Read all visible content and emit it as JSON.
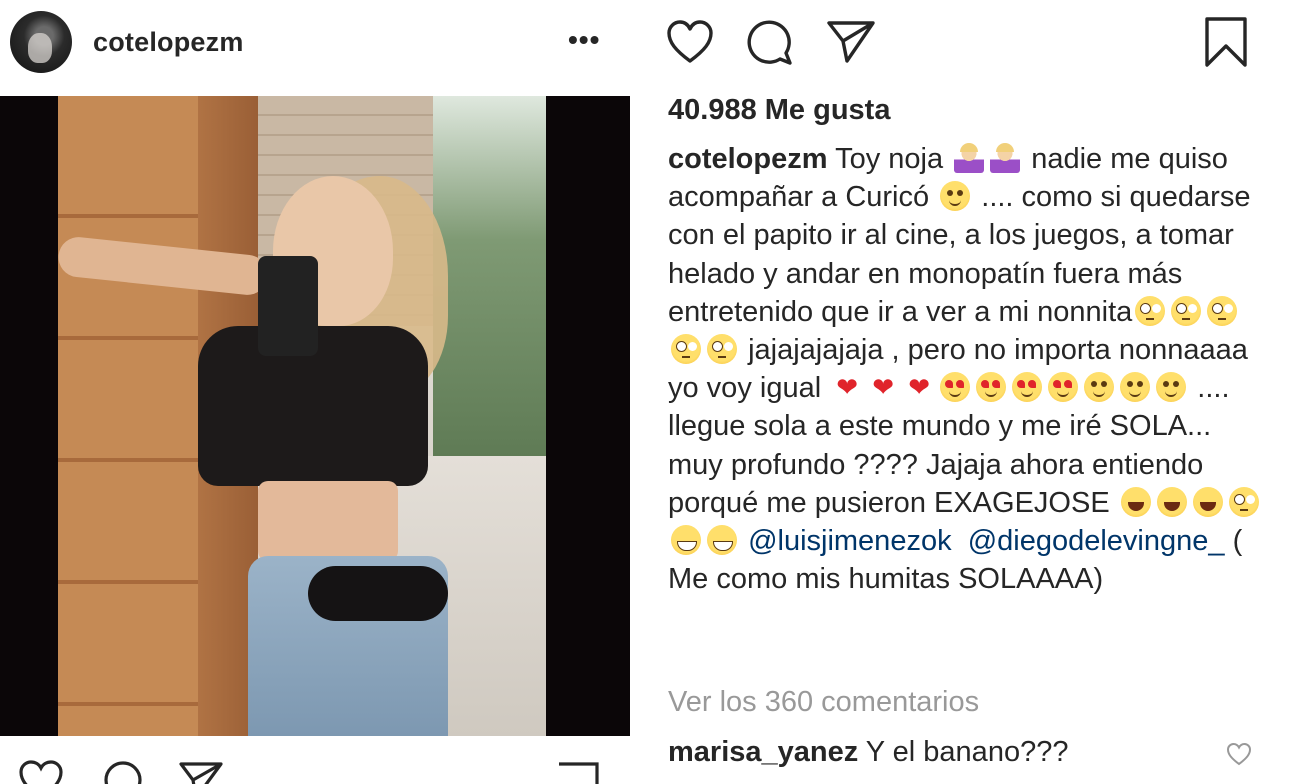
{
  "post": {
    "username": "cotelopezm",
    "more_label": "•••",
    "likes": "40.988 Me gusta",
    "caption_user": "cotelopezm",
    "caption_parts": {
      "p1": "Toy noja",
      "p2": "nadie me quiso acompañar a Curicó",
      "p3": ".... como si quedarse con el papito ir al cine, a los juegos, a tomar helado y andar en monopatín fuera más entretenido que ir a ver a mi nonnita",
      "p4": "jajajajajaja , pero no importa nonnaaaa yo voy igual",
      "p5": ".... llegue sola a este mundo y me iré SOLA... muy profundo ???? Jajaja ahora entiendo porqué me pusieron EXAGEJOSE",
      "mention1": "@luisjimenezok",
      "mention2": "@diegodelevingne_",
      "p6": "( Me como mis humitas SOLAAAA)"
    },
    "view_comments": "Ver los 360 comentarios",
    "comment": {
      "user": "marisa_yanez",
      "text": "Y el banano???"
    }
  },
  "icons": {
    "action_bar": [
      "heart-icon",
      "comment-icon",
      "share-icon",
      "bookmark-icon"
    ],
    "emoji": [
      "person-gesturing-no",
      "person-gesturing-ok",
      "unamused-face",
      "face-with-rolling-eyes",
      "red-heart",
      "smiling-face-with-heart-eyes",
      "smiling-face",
      "face-with-tears-of-joy",
      "grinning-face"
    ]
  },
  "colors": {
    "text": "#262626",
    "muted": "#999999",
    "mention": "#003569",
    "photo_frame": "#0b0608"
  }
}
